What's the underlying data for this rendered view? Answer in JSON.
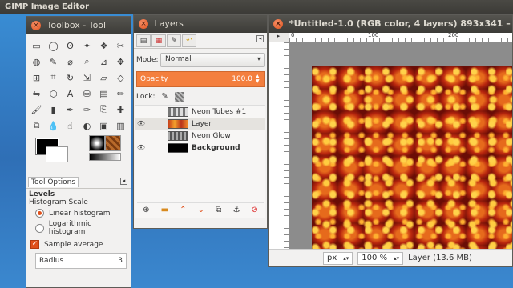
{
  "app": {
    "title": "GIMP Image Editor"
  },
  "toolbox": {
    "title": "Toolbox - Tool",
    "close": "×",
    "tools": [
      {
        "name": "rect-select-icon",
        "glyph": "▭"
      },
      {
        "name": "ellipse-select-icon",
        "glyph": "◯"
      },
      {
        "name": "free-select-icon",
        "glyph": "ʘ"
      },
      {
        "name": "fuzzy-select-icon",
        "glyph": "✦"
      },
      {
        "name": "color-select-icon",
        "glyph": "❖"
      },
      {
        "name": "scissors-icon",
        "glyph": "✂"
      },
      {
        "name": "foreground-select-icon",
        "glyph": "◍"
      },
      {
        "name": "paths-icon",
        "glyph": "✎"
      },
      {
        "name": "color-picker-icon",
        "glyph": "⌀"
      },
      {
        "name": "zoom-icon",
        "glyph": "⌕"
      },
      {
        "name": "measure-icon",
        "glyph": "⊿"
      },
      {
        "name": "move-icon",
        "glyph": "✥"
      },
      {
        "name": "align-icon",
        "glyph": "⊞"
      },
      {
        "name": "crop-icon",
        "glyph": "⌗"
      },
      {
        "name": "rotate-icon",
        "glyph": "↻"
      },
      {
        "name": "scale-icon",
        "glyph": "⇲"
      },
      {
        "name": "shear-icon",
        "glyph": "▱"
      },
      {
        "name": "perspective-icon",
        "glyph": "◇"
      },
      {
        "name": "flip-icon",
        "glyph": "⇋"
      },
      {
        "name": "cage-icon",
        "glyph": "⬡"
      },
      {
        "name": "text-icon",
        "glyph": "A"
      },
      {
        "name": "bucket-fill-icon",
        "glyph": "⛁"
      },
      {
        "name": "blend-icon",
        "glyph": "▤"
      },
      {
        "name": "pencil-icon",
        "glyph": "✏"
      },
      {
        "name": "paintbrush-icon",
        "glyph": "🖌"
      },
      {
        "name": "eraser-icon",
        "glyph": "▮"
      },
      {
        "name": "airbrush-icon",
        "glyph": "✒"
      },
      {
        "name": "ink-icon",
        "glyph": "✑"
      },
      {
        "name": "clone-icon",
        "glyph": "⎘"
      },
      {
        "name": "heal-icon",
        "glyph": "✚"
      },
      {
        "name": "perspective-clone-icon",
        "glyph": "⧉"
      },
      {
        "name": "blur-icon",
        "glyph": "💧"
      },
      {
        "name": "smudge-icon",
        "glyph": "☝"
      },
      {
        "name": "dodge-burn-icon",
        "glyph": "◐"
      },
      {
        "name": "extra-tool-icon",
        "glyph": "▣"
      },
      {
        "name": "extra-tool-2-icon",
        "glyph": "▥"
      }
    ],
    "tool_options_tab": "Tool Options",
    "levels_label": "Levels",
    "histogram_scale_label": "Histogram Scale",
    "linear_label": "Linear histogram",
    "log_label": "Logarithmic histogram",
    "sample_average_label": "Sample average",
    "radius_label": "Radius",
    "radius_value": "3"
  },
  "layers": {
    "title": "Layers",
    "mode_label": "Mode:",
    "mode_value": "Normal",
    "opacity_label": "Opacity",
    "opacity_value": "100.0",
    "lock_label": "Lock:",
    "items": [
      {
        "name": "Neon Tubes #1",
        "visible": false,
        "bold": false,
        "selected": false,
        "thumb": "neon"
      },
      {
        "name": "Layer",
        "visible": true,
        "bold": false,
        "selected": true,
        "thumb": "fire"
      },
      {
        "name": "Neon Glow",
        "visible": false,
        "bold": false,
        "selected": false,
        "thumb": "glow"
      },
      {
        "name": "Background",
        "visible": true,
        "bold": true,
        "selected": false,
        "thumb": "black"
      }
    ]
  },
  "image_window": {
    "title": "*Untitled-1.0 (RGB color, 4 layers) 893x341 –",
    "ruler_ticks": [
      "0",
      "100",
      "200"
    ],
    "unit": "px",
    "zoom": "100 %",
    "status": "Layer (13.6 MB)"
  },
  "colors": {
    "accent": "#f47f3e",
    "titlebar": "#3c3b37",
    "close": "#e0501b"
  }
}
